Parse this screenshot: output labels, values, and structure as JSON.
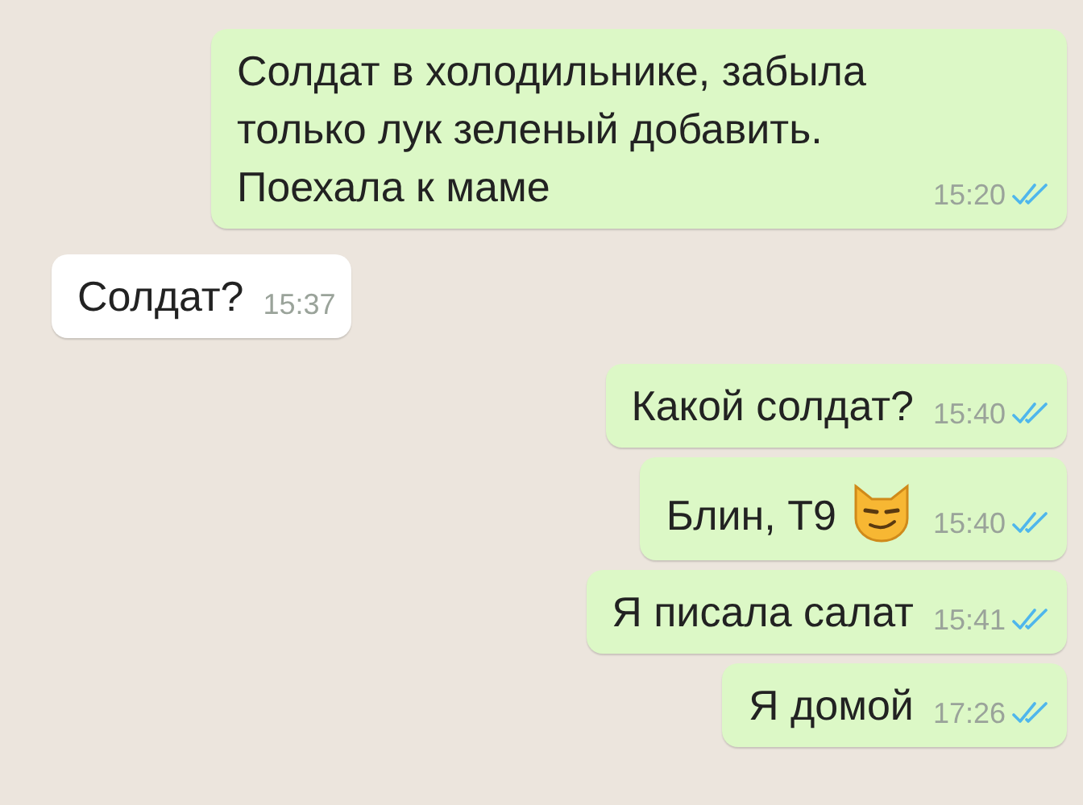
{
  "messages": [
    {
      "kind": "outgoing",
      "text": "Солдат в холодильнике, забыла только лук зеленый добавить. Поехала к маме",
      "time": "15:20",
      "read": true,
      "emoji": false
    },
    {
      "kind": "incoming",
      "text": "Солдат?",
      "time": "15:37",
      "emoji": false
    },
    {
      "kind": "outgoing",
      "text": "Какой солдат?",
      "time": "15:40",
      "read": true,
      "emoji": false
    },
    {
      "kind": "outgoing",
      "text": "Блин, Т9",
      "time": "15:40",
      "read": true,
      "emoji": true
    },
    {
      "kind": "outgoing",
      "text": "Я писала салат",
      "time": "15:41",
      "read": true,
      "emoji": false
    },
    {
      "kind": "outgoing",
      "text": "Я домой",
      "time": "17:26",
      "read": true,
      "emoji": false
    }
  ]
}
